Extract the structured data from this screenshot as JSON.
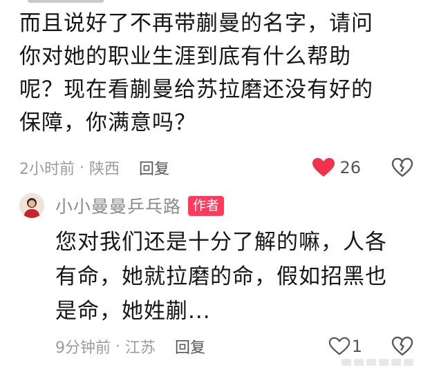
{
  "comment": {
    "text": "而且说好了不再带蒯曼的名字，请问\n你对她的职业生涯到底有什么帮助\n呢？现在看蒯曼给苏拉磨还没有好的\n保障，你满意吗？",
    "time": "2小时前",
    "location": "陕西",
    "reply_label": "回复",
    "like_count": "26",
    "liked": true,
    "like_color": "#f0324e"
  },
  "reply": {
    "author": "小小曼曼乒乓路",
    "author_badge": "作者",
    "badge_color": "#ff3b5c",
    "text": "您对我们还是十分了解的嘛，人各\n有命，她就拉磨的命，假如招黑也\n是命，她姓蒯...",
    "time": "9分钟前",
    "location": "江苏",
    "reply_label": "回复",
    "like_count": "1",
    "liked": false
  },
  "icons": {
    "like": "heart-icon",
    "dislike": "broken-heart-icon"
  }
}
